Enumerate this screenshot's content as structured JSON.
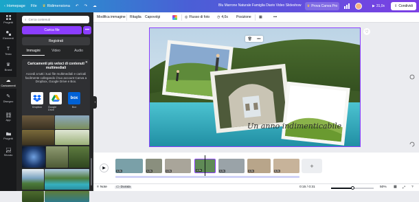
{
  "topbar": {
    "home": "Homepage",
    "file": "File",
    "resize": "Ridimensiona",
    "title": "Blu Marrone Naturale Famiglia Diario Video Slideshow",
    "pro_button": "Prova Canva Pro",
    "play_time": "31,0s",
    "share": "Condividi"
  },
  "rail": {
    "items": [
      {
        "label": "Progetti",
        "icon": "grid-icon"
      },
      {
        "label": "Elementi",
        "icon": "shapes-icon"
      },
      {
        "label": "Testo",
        "icon": "text-icon"
      },
      {
        "label": "Brand",
        "icon": "crown-icon"
      },
      {
        "label": "Caricamenti",
        "icon": "cloud-upload-icon"
      },
      {
        "label": "Disegno",
        "icon": "pen-icon"
      },
      {
        "label": "App",
        "icon": "apps-icon"
      },
      {
        "label": "Progetti",
        "icon": "folder-icon"
      },
      {
        "label": "Sfondo",
        "icon": "background-icon"
      }
    ]
  },
  "panel": {
    "search_placeholder": "Cerca contenuti",
    "upload_label": "Carica file",
    "more": "•••",
    "record_label": "Registrati",
    "tabs": [
      "Immagini",
      "Video",
      "Audio"
    ],
    "promo": {
      "title": "Caricamenti più veloci di contenuti multimediali",
      "text": "Accedi a tutti i tuoi file multimediali e caricali facilmente collegando il tuo account Canva a Dropbox, Google Drive e Box.",
      "services": [
        {
          "label": "Dropbox",
          "icon": "dropbox-icon"
        },
        {
          "label": "Google Drive",
          "icon": "google-drive-icon"
        },
        {
          "label": "Box",
          "icon": "box-icon"
        }
      ]
    }
  },
  "toolbar": {
    "edit_image": "Modifica immagine",
    "crop": "Ritaglia",
    "flip": "Capovolgi",
    "photo_fade": "Flusso di foto",
    "duration": "4,0s",
    "position": "Posizione"
  },
  "canvas": {
    "caption": "Un anno indimenticabile"
  },
  "timeline": {
    "clips": [
      {
        "duration": "4,0s",
        "color": "#7aa0a8"
      },
      {
        "duration": "4,0s",
        "color": "#8a8f7e"
      },
      {
        "duration": "4,0s",
        "color": "#a9a59a"
      },
      {
        "duration": "4,0s",
        "color": "#5f8a56"
      },
      {
        "duration": "4,0s",
        "color": "#9aa3a8"
      },
      {
        "duration": "4,0s",
        "color": "#b8a58a"
      },
      {
        "duration": "6,0s",
        "color": "#c7b39a"
      }
    ],
    "add": "+"
  },
  "bottombar": {
    "notes": "Note",
    "duration": "Durata",
    "time": "0:15 / 0:31",
    "zoom": "50%",
    "zoom_value": 0.5
  },
  "colors": {
    "accent": "#8b3dff",
    "rail_bg": "#18191b",
    "panel_bg": "#252627"
  }
}
